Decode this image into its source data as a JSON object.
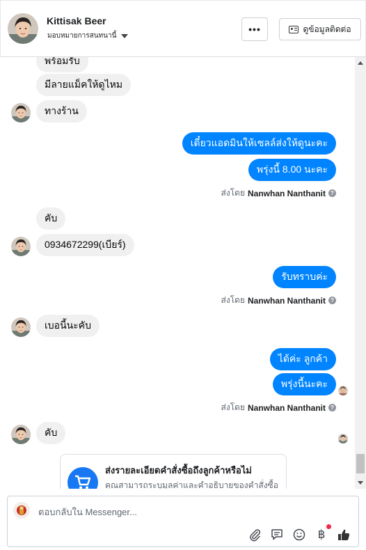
{
  "header": {
    "contact_name": "Kittisak Beer",
    "assign_label": "มอบหมายการสนทนานี้",
    "more_label": "•••",
    "contact_info_label": "ดูข้อมูลติดต่อ"
  },
  "messages": [
    {
      "side": "in",
      "text": "พร้อมรับ"
    },
    {
      "side": "in",
      "text": "มีลายแม็คให้ดูไหม"
    },
    {
      "side": "in",
      "text": "ทางร้าน"
    },
    {
      "side": "out",
      "text": "เดี๋ยวแอดมินให้เซลล์ส่งให้ดูนะคะ"
    },
    {
      "side": "out",
      "text": "พรุ่งนี้ 8.00 นะคะ"
    },
    {
      "side": "meta",
      "prefix": "ส่งโดย",
      "name": "Nanwhan Nanthanit"
    },
    {
      "side": "in",
      "text": "คับ"
    },
    {
      "side": "in",
      "text": "0934672299(เบียร์)"
    },
    {
      "side": "out",
      "text": "รับทราบค่ะ"
    },
    {
      "side": "meta",
      "prefix": "ส่งโดย",
      "name": "Nanwhan Nanthanit"
    },
    {
      "side": "in",
      "text": "เบอนี้นะคับ"
    },
    {
      "side": "out",
      "text": "ได้ค่ะ ลูกค้า"
    },
    {
      "side": "out",
      "text": "พรุ่งนี้นะคะ"
    },
    {
      "side": "meta",
      "prefix": "ส่งโดย",
      "name": "Nanwhan Nanthanit"
    },
    {
      "side": "in",
      "text": "คับ"
    }
  ],
  "order_card": {
    "title": "ส่งรายละเอียดคำสั่งซื้อถึงลูกค้าหรือไม่",
    "description": "คุณสามารถระบุมูลค่าและคำอธิบายของคำสั่งซื้อ",
    "icon": "shopping-cart-icon"
  },
  "composer": {
    "placeholder": "ตอบกลับใน Messenger...",
    "currency_symbol": "฿",
    "tools": [
      "paperclip-icon",
      "saved-reply-icon",
      "emoji-icon",
      "payment-icon",
      "like-icon"
    ]
  },
  "colors": {
    "outgoing_bubble": "#0084ff",
    "incoming_bubble": "#f0f0f0",
    "accent": "#1877f2"
  }
}
